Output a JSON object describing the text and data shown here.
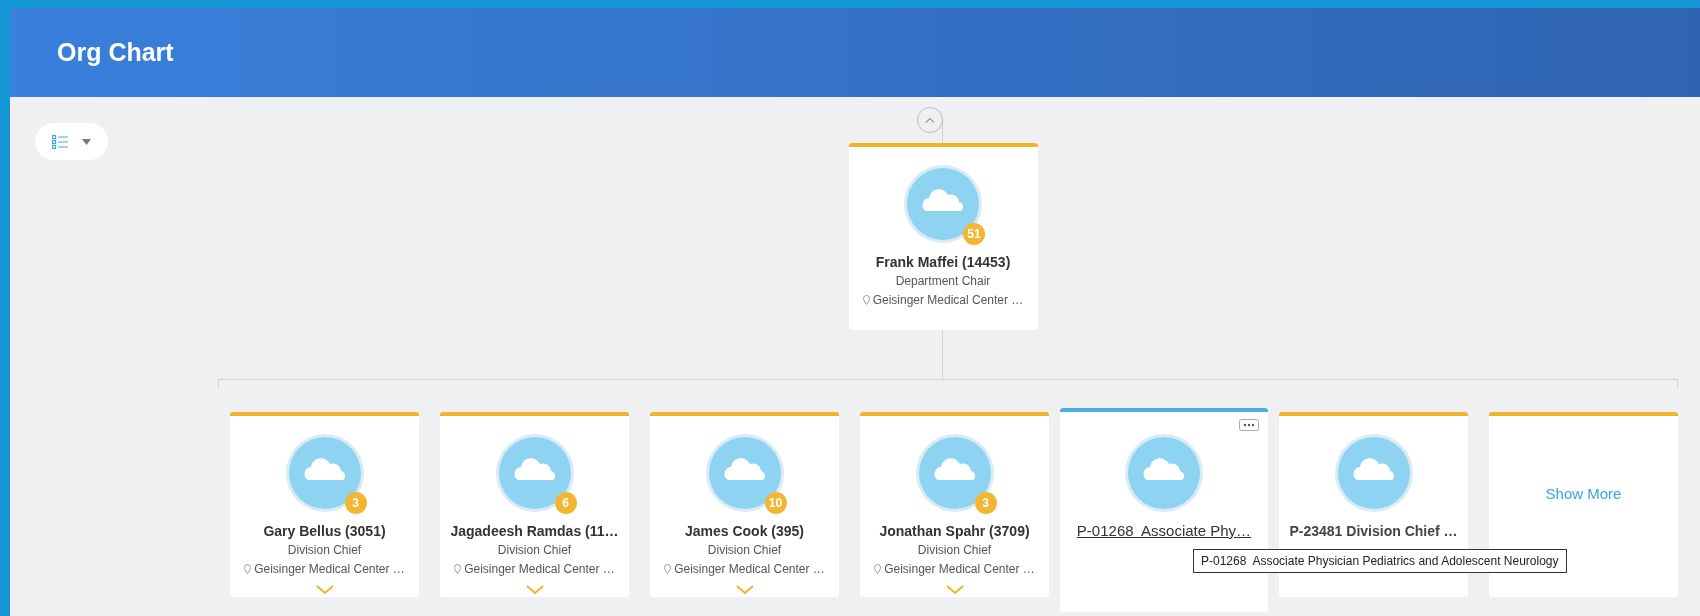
{
  "header": {
    "title": "Org Chart"
  },
  "manager": {
    "name": "Frank Maffei (14453)",
    "title": "Department Chair",
    "location": "Geisinger Medical Center …",
    "count": "51"
  },
  "reports": [
    {
      "kind": "person",
      "name": "Gary Bellus (3051)",
      "title": "Division Chief",
      "location": "Geisinger Medical Center …",
      "count": "3",
      "selected": false
    },
    {
      "kind": "person",
      "name": "Jagadeesh Ramdas (11…",
      "title": "Division Chief",
      "location": "Geisinger Medical Center …",
      "count": "6",
      "selected": false
    },
    {
      "kind": "person",
      "name": "James Cook (395)",
      "title": "Division Chief",
      "location": "Geisinger Medical Center …",
      "count": "10",
      "selected": false
    },
    {
      "kind": "person",
      "name": "Jonathan Spahr (3709)",
      "title": "Division Chief",
      "location": "Geisinger Medical Center …",
      "count": "3",
      "selected": false
    },
    {
      "kind": "position",
      "name": "P-01268  Associate Phy…",
      "selected": true
    },
    {
      "kind": "position",
      "name": "P-23481 Division Chief …",
      "selected": false
    },
    {
      "kind": "show_more",
      "label": "Show More",
      "selected": false
    }
  ],
  "tooltip": "P-01268  Associate Physician Pediatrics and Adolescent Neurology"
}
